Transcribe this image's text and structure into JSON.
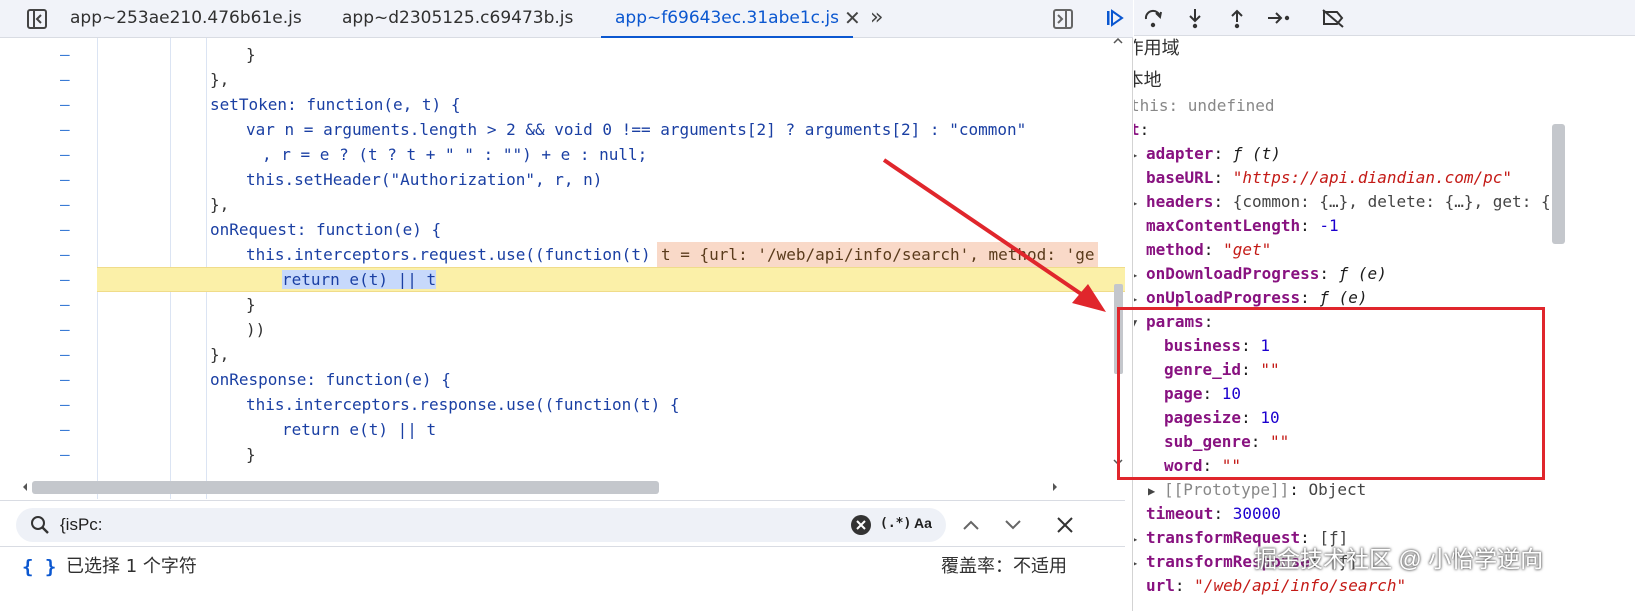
{
  "tabs": [
    {
      "label": "app~253ae210.476b61e.js"
    },
    {
      "label": "app~d2305125.c69473b.js"
    },
    {
      "label": "app~f69643ec.31abe1c.js",
      "active": true
    }
  ],
  "code_lines": [
    {
      "text": "}"
    },
    {
      "text": "},"
    },
    {
      "text": "setToken: function(e, t) {"
    },
    {
      "text": "var n = arguments.length > 2 && void 0 !== arguments[2] ? arguments[2] : \"common\""
    },
    {
      "text": ", r = e ? (t ? t + \" \" : \"\") + e : null;"
    },
    {
      "text": "this.setHeader(\"Authorization\", r, n)"
    },
    {
      "text": "},"
    },
    {
      "text": "onRequest: function(e) {"
    },
    {
      "text": "this.interceptors.request.use((function(t) {"
    },
    {
      "text": "return e(t) || t"
    },
    {
      "text": "}"
    },
    {
      "text": "))"
    },
    {
      "text": "},"
    },
    {
      "text": "onResponse: function(e) {"
    },
    {
      "text": "this.interceptors.response.use((function(t) {"
    },
    {
      "text": "return e(t) || t"
    },
    {
      "text": "}"
    }
  ],
  "inline_value": "t = {url: '/web/api/info/search', method: 'ge",
  "search": {
    "value": "{isPc:",
    "regex_label": "(.*)",
    "case_label": "Aa"
  },
  "status": {
    "selection": "已选择 1 个字符",
    "coverage": "覆盖率：不适用",
    "braces": "{ }"
  },
  "scope": {
    "section": "作用域",
    "local": "本地",
    "this_key": "this",
    "this_val": "undefined",
    "t_key": "t",
    "props": [
      {
        "key": "adapter",
        "val": "ƒ (t)",
        "kind": "f",
        "tri": "▶"
      },
      {
        "key": "baseURL",
        "val": "\"https://api.diandian.com/pc\"",
        "kind": "s",
        "tri": ""
      },
      {
        "key": "headers",
        "val": "{common: {…}, delete: {…}, get: {",
        "kind": "o",
        "tri": "▶"
      },
      {
        "key": "maxContentLength",
        "val": "-1",
        "kind": "n",
        "tri": ""
      },
      {
        "key": "method",
        "val": "\"get\"",
        "kind": "s",
        "tri": ""
      },
      {
        "key": "onDownloadProgress",
        "val": "ƒ (e)",
        "kind": "f",
        "tri": "▶"
      },
      {
        "key": "onUploadProgress",
        "val": "ƒ (e)",
        "kind": "f",
        "tri": "▶"
      }
    ],
    "params_key": "params",
    "params": [
      {
        "key": "business",
        "val": "1",
        "kind": "n"
      },
      {
        "key": "genre_id",
        "val": "\"\"",
        "kind": "s"
      },
      {
        "key": "page",
        "val": "10",
        "kind": "n"
      },
      {
        "key": "pagesize",
        "val": "10",
        "kind": "n"
      },
      {
        "key": "sub_genre",
        "val": "\"\"",
        "kind": "s"
      },
      {
        "key": "word",
        "val": "\"\"",
        "kind": "s"
      }
    ],
    "prototype_key": "[[Prototype]]",
    "prototype_val": "Object",
    "after": [
      {
        "key": "timeout",
        "val": "30000",
        "kind": "n",
        "tri": ""
      },
      {
        "key": "transformRequest",
        "val": "[ƒ]",
        "kind": "o",
        "tri": "▶"
      },
      {
        "key": "transformResponse",
        "val": "[ƒ]",
        "kind": "o",
        "tri": "▶"
      },
      {
        "key": "url",
        "val": "\"/web/api/info/search\"",
        "kind": "s",
        "tri": ""
      }
    ]
  },
  "watermark": "掘金技术社区 @ 小怡学逆向",
  "colors": {
    "accent": "#0b57d0",
    "annotation": "#e0262c",
    "highlight": "#fbf0a8"
  }
}
